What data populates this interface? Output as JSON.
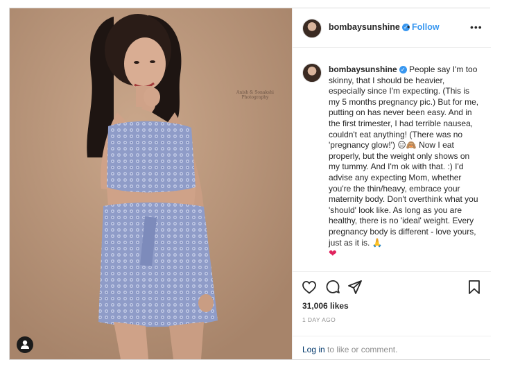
{
  "post": {
    "username": "bombaysunshine",
    "follow_label": "Follow",
    "more_label": "•••",
    "caption": "People say I'm too skinny, that I should be heavier, especially since I'm expecting. (This is my 5 months pregnancy pic.) But for me, putting on has never been easy. And in the first trimester, I had terrible nausea, couldn't eat anything! (There was no 'pregnancy glow!') 😑🙈 Now I eat properly, but the weight only shows on my tummy. And I'm ok with that. :) I'd advise any expecting Mom, whether you're the thin/heavy, embrace your maternity body. Don't overthink what you 'should' look like. As long as you are healthy, there is no 'ideal' weight. Every pregnancy body is different - love yours, just as it is. 🙏",
    "caption_heart": "❤",
    "likes": "31,006 likes",
    "time_ago": "1 DAY AGO",
    "login_link": "Log in",
    "login_suffix": " to like or comment."
  },
  "photo": {
    "credit_line1": "Anish & Sonakshi",
    "credit_line2": "Photography"
  },
  "colors": {
    "accent": "#3897f0",
    "text": "#262626",
    "muted": "#8e8e8e",
    "heart": "#e0245e",
    "photo_background": "#bf9b7f"
  },
  "icons": [
    "like-icon",
    "comment-icon",
    "share-icon",
    "save-icon",
    "user-icon",
    "verified-icon"
  ]
}
